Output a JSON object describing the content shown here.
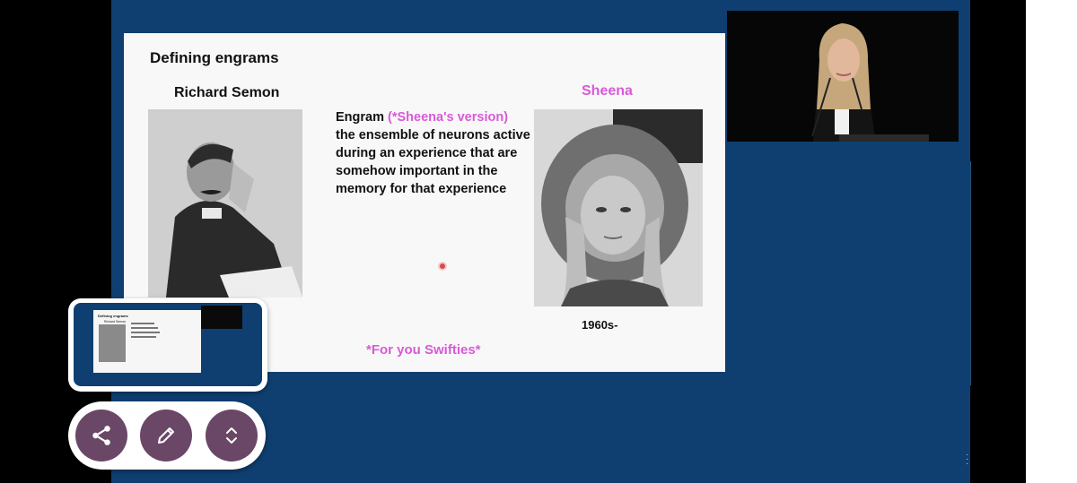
{
  "slide": {
    "title": "Defining engrams",
    "semon_name": "Richard Semon",
    "engram_label": "Engram",
    "engram_version": "(*Sheena's version)",
    "engram_definition": "the ensemble of neurons active during an experience that are somehow important in the memory for that experience",
    "sheena_name": "Sheena",
    "era": "1960s-",
    "swifties": "*For you Swifties*"
  },
  "thumbnail": {
    "title": "Defining engrams",
    "semon_name": "Richard Semon"
  },
  "controls": {
    "share_icon": "share-icon",
    "edit_icon": "pencil-icon",
    "expand_icon": "expand-vertical-icon"
  },
  "colors": {
    "stage_background": "#0f3f70",
    "accent_pink": "#d85ad8",
    "fab_color": "#6a4766"
  }
}
